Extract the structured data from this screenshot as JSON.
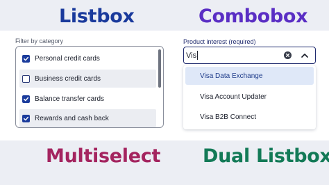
{
  "headings": {
    "listbox": "Listbox",
    "combobox": "Combobox",
    "multiselect": "Multiselect",
    "dual_listbox": "Dual Listbox"
  },
  "listbox": {
    "label": "Filter by category",
    "items": [
      {
        "label": "Personal credit cards",
        "checked": true
      },
      {
        "label": "Business credit cards",
        "checked": false
      },
      {
        "label": "Balance transfer cards",
        "checked": true
      },
      {
        "label": "Rewards and cash back",
        "checked": true
      }
    ]
  },
  "combobox": {
    "label": "Product interest (required)",
    "value": "Vis",
    "options": [
      {
        "label": "Visa Data Exchange",
        "active": true
      },
      {
        "label": "Visa Account Updater",
        "active": false
      },
      {
        "label": "Visa B2B Connect",
        "active": false
      }
    ]
  },
  "colors": {
    "listbox_heading": "#1a3a9c",
    "combobox_heading": "#5a2ec4",
    "multiselect_heading": "#a4245f",
    "dual_listbox_heading": "#137a57",
    "checkbox_checked": "#1b3c9c",
    "option_highlight": "#dfe8f8"
  },
  "icons": {
    "check": "checkmark-icon",
    "clear": "clear-icon",
    "toggle": "chevron-up-icon"
  }
}
